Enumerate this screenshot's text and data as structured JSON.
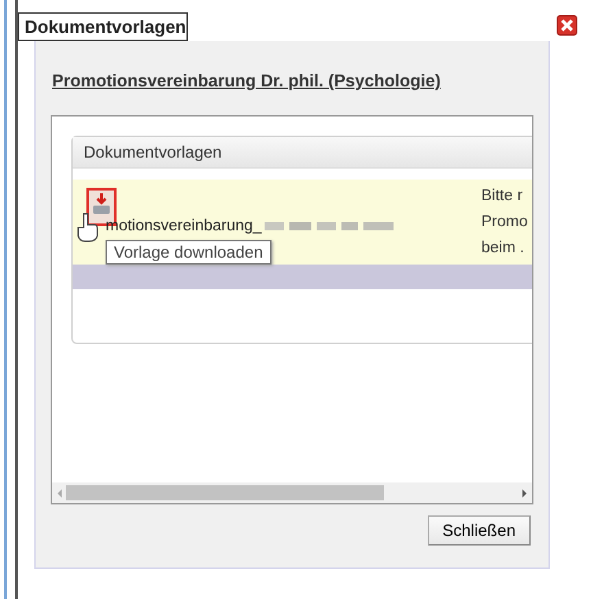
{
  "dialog": {
    "tab_title": "Dokumentvorlagen",
    "heading": "Promotionsvereinbarung Dr. phil. (Psychologie)",
    "section": {
      "title": "Dokumentvorlagen",
      "rows": [
        {
          "file_name": "motionsvereinbarung_",
          "description_lines": [
            "Bitte r",
            "Promo",
            "beim ."
          ]
        }
      ]
    },
    "tooltip": "Vorlage downloaden",
    "buttons": [
      "Schließen"
    ]
  }
}
